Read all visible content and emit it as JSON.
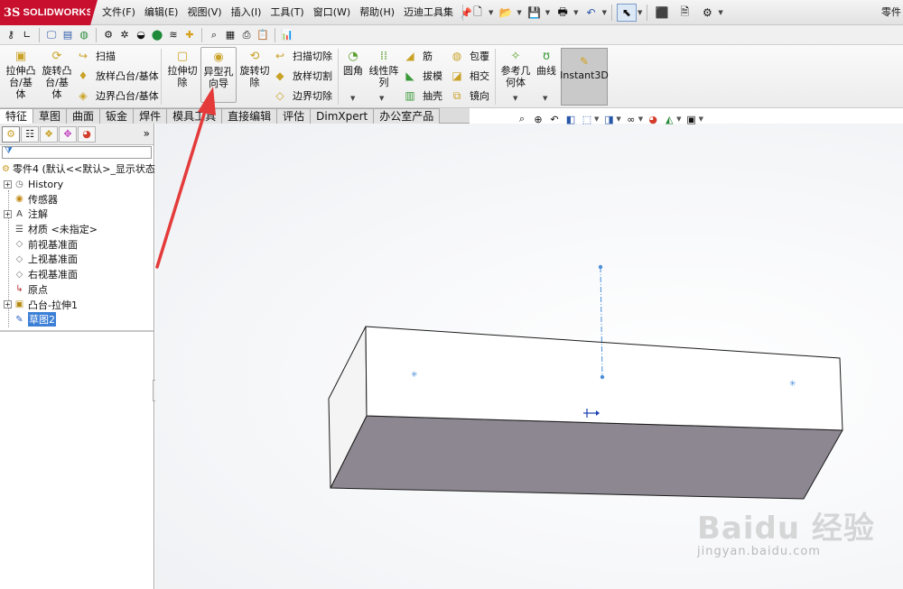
{
  "app": {
    "logo_ds": "3S",
    "logo_brand": "SOLIDWORKS",
    "doc_title": "零件"
  },
  "menu": {
    "items": [
      "文件(F)",
      "编辑(E)",
      "视图(V)",
      "插入(I)",
      "工具(T)",
      "窗口(W)",
      "帮助(H)",
      "迈迪工具集"
    ]
  },
  "ribbon": {
    "extrude_boss": "拉伸凸\n台/基\n体",
    "revolve_boss": "旋转凸\n台/基\n体",
    "sweep": "扫描",
    "loft_boss": "放样凸台/基体",
    "boundary_boss": "边界凸台/基体",
    "extrude_cut": "拉伸切\n除",
    "hole_wizard": "异型孔\n向导",
    "revolve_cut": "旋转切\n除",
    "sweep_cut": "扫描切除",
    "loft_cut": "放样切割",
    "boundary_cut": "边界切除",
    "fillet": "圆角",
    "linear_pattern": "线性阵\n列",
    "rib": "筋",
    "draft": "拔模",
    "shell": "抽壳",
    "wrap": "包覆",
    "intersect": "相交",
    "mirror": "镜向",
    "ref_geometry": "参考几\n何体",
    "curves": "曲线",
    "instant3d": "Instant3D"
  },
  "tabs": [
    {
      "label": "特征",
      "active": true
    },
    {
      "label": "草图",
      "active": false
    },
    {
      "label": "曲面",
      "active": false
    },
    {
      "label": "钣金",
      "active": false
    },
    {
      "label": "焊件",
      "active": false
    },
    {
      "label": "模具工具",
      "active": false
    },
    {
      "label": "直接编辑",
      "active": false
    },
    {
      "label": "评估",
      "active": false
    },
    {
      "label": "DimXpert",
      "active": false
    },
    {
      "label": "办公室产品",
      "active": false
    }
  ],
  "panel": {
    "expand_label": "»",
    "tree": [
      {
        "label": "零件4 (默认<<默认>_显示状态",
        "expander": false,
        "icon": "part-icon",
        "glyph": "⚙",
        "color": "#c99a1e"
      },
      {
        "label": "History",
        "expander": true,
        "icon": "history-icon",
        "glyph": "◷",
        "color": "#6a6a6a"
      },
      {
        "label": "传感器",
        "expander": false,
        "icon": "sensor-icon",
        "glyph": "◉",
        "color": "#c28a18"
      },
      {
        "label": "注解",
        "expander": true,
        "icon": "annotation-icon",
        "glyph": "A",
        "color": "#3a3a3a"
      },
      {
        "label": "材质 <未指定>",
        "expander": false,
        "icon": "material-icon",
        "glyph": "☰",
        "color": "#4a4a4a"
      },
      {
        "label": "前视基准面",
        "expander": false,
        "icon": "plane-icon",
        "glyph": "◇",
        "color": "#777"
      },
      {
        "label": "上视基准面",
        "expander": false,
        "icon": "plane-icon",
        "glyph": "◇",
        "color": "#777"
      },
      {
        "label": "右视基准面",
        "expander": false,
        "icon": "plane-icon",
        "glyph": "◇",
        "color": "#777"
      },
      {
        "label": "原点",
        "expander": false,
        "icon": "origin-icon",
        "glyph": "↳",
        "color": "#b03030"
      },
      {
        "label": "凸台-拉伸1",
        "expander": true,
        "icon": "extrude-feature-icon",
        "glyph": "▣",
        "color": "#b58a10"
      },
      {
        "label": "草图2",
        "expander": false,
        "icon": "sketch-icon",
        "glyph": "✎",
        "color": "#2e64c4",
        "selected": true
      }
    ]
  },
  "watermark": {
    "main": "Baidu 经验",
    "sub": "jingyan.baidu.com"
  },
  "colors": {
    "brand_red": "#c8102e",
    "annotation_red": "#e43a3a",
    "selection_blue": "#3c7fd6",
    "sketch_blue": "#4a8fd8",
    "body_top": "#ffffff",
    "body_front": "#8d8791"
  }
}
